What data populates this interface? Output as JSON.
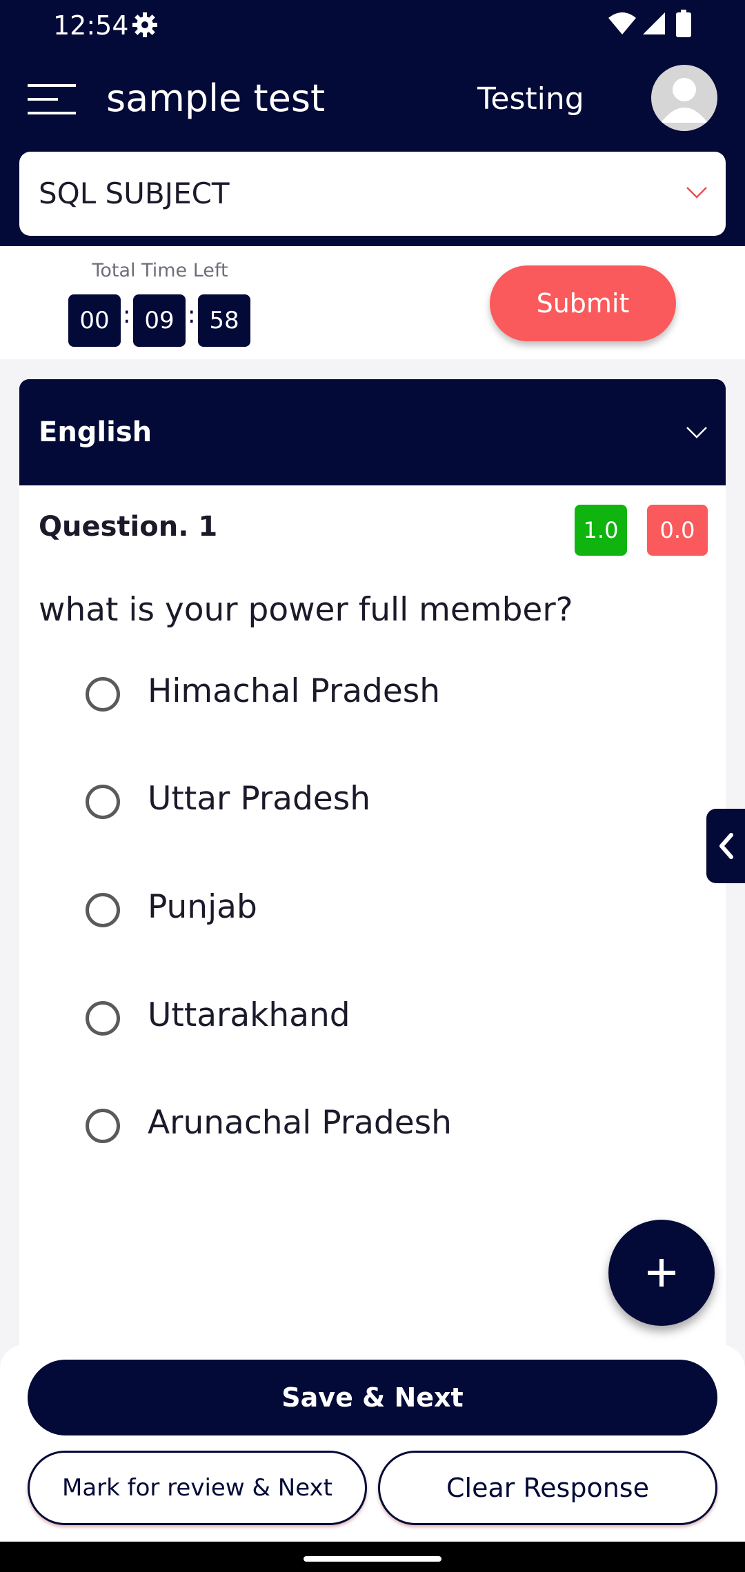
{
  "status_bar": {
    "time": "12:54"
  },
  "header": {
    "title": "sample test",
    "user": "Testing",
    "subject": "SQL SUBJECT"
  },
  "timer": {
    "caption": "Total Time Left",
    "hours": "00",
    "minutes": "09",
    "seconds": "58",
    "separator": ":"
  },
  "submit_label": "Submit",
  "language": "English",
  "question": {
    "number_label": "Question. 1",
    "positive_marks": "1.0",
    "negative_marks": "0.0",
    "text": "what is your power full member?",
    "options": [
      "Himachal Pradesh",
      "Uttar Pradesh",
      "Punjab",
      "Uttarakhand",
      "Arunachal Pradesh"
    ]
  },
  "actions": {
    "save_next": "Save & Next",
    "mark_review": "Mark for review & Next",
    "clear_response": "Clear Response"
  },
  "colors": {
    "navy": "#040a38",
    "submit_red": "#fa5a5c",
    "positive_green": "#10b40e",
    "negative_red": "#fa5a5c"
  }
}
